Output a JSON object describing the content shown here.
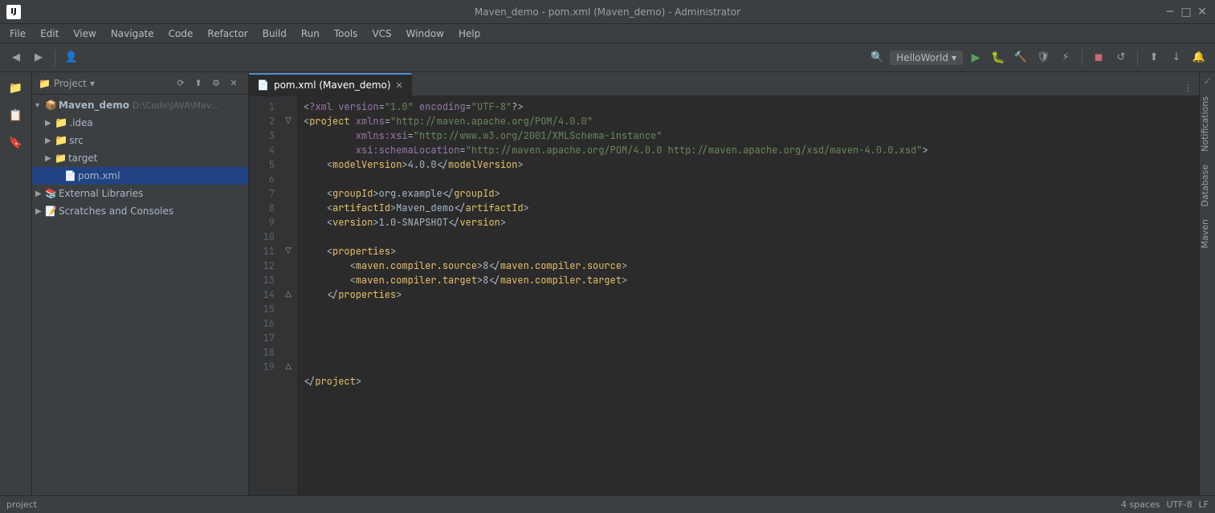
{
  "window": {
    "title": "Maven_demo - pom.xml (Maven_demo) - Administrator",
    "logo": "IJ"
  },
  "titleBar": {
    "title": "Maven_demo - pom.xml (Maven_demo) - Administrator",
    "minimize": "─",
    "maximize": "□",
    "close": "✕"
  },
  "menuBar": {
    "items": [
      "File",
      "Edit",
      "View",
      "Navigate",
      "Code",
      "Refactor",
      "Build",
      "Run",
      "Tools",
      "VCS",
      "Window",
      "Help"
    ]
  },
  "breadcrumb": {
    "project": "Maven_demo",
    "file": "pom.xml"
  },
  "toolbar": {
    "runConfig": "HelloWorld",
    "runLabel": "▶",
    "buildLabel": "🔨"
  },
  "projectPanel": {
    "title": "Project",
    "rootItem": {
      "name": "Maven_demo",
      "path": "D:\\Code\\JAVA\\Mav...",
      "expanded": true
    },
    "items": [
      {
        "id": "idea",
        "label": ".idea",
        "type": "folder",
        "indent": 1,
        "expanded": false
      },
      {
        "id": "src",
        "label": "src",
        "type": "folder",
        "indent": 1,
        "expanded": false
      },
      {
        "id": "target",
        "label": "target",
        "type": "folder-orange",
        "indent": 1,
        "expanded": false
      },
      {
        "id": "pom",
        "label": "pom.xml",
        "type": "file-xml",
        "indent": 2,
        "selected": true
      },
      {
        "id": "external",
        "label": "External Libraries",
        "type": "library",
        "indent": 0,
        "expanded": false
      },
      {
        "id": "scratches",
        "label": "Scratches and Consoles",
        "type": "scratches",
        "indent": 0
      }
    ]
  },
  "editor": {
    "tabs": [
      {
        "label": "pom.xml (Maven_demo)",
        "active": true,
        "closable": true
      }
    ],
    "lines": [
      {
        "num": 1,
        "content": "<?xml version=\"1.0\" encoding=\"UTF-8\"?>",
        "gutter": ""
      },
      {
        "num": 2,
        "content": "<project xmlns=\"http://maven.apache.org/POM/4.0.0\"",
        "gutter": "fold"
      },
      {
        "num": 3,
        "content": "         xmlns:xsi=\"http://www.w3.org/2001/XMLSchema-instance\"",
        "gutter": ""
      },
      {
        "num": 4,
        "content": "         xsi:schemaLocation=\"http://maven.apache.org/POM/4.0.0 http://maven.apache.org/xsd/maven-4.0.0.xsd\">",
        "gutter": ""
      },
      {
        "num": 5,
        "content": "    <modelVersion>4.0.0</modelVersion>",
        "gutter": ""
      },
      {
        "num": 6,
        "content": "",
        "gutter": ""
      },
      {
        "num": 7,
        "content": "    <groupId>org.example</groupId>",
        "gutter": ""
      },
      {
        "num": 8,
        "content": "    <artifactId>Maven_demo</artifactId>",
        "gutter": ""
      },
      {
        "num": 9,
        "content": "    <version>1.0-SNAPSHOT</version>",
        "gutter": ""
      },
      {
        "num": 10,
        "content": "",
        "gutter": ""
      },
      {
        "num": 11,
        "content": "    <properties>",
        "gutter": "fold"
      },
      {
        "num": 12,
        "content": "        <maven.compiler.source>8</maven.compiler.source>",
        "gutter": ""
      },
      {
        "num": 13,
        "content": "        <maven.compiler.target>8</maven.compiler.target>",
        "gutter": ""
      },
      {
        "num": 14,
        "content": "    </properties>",
        "gutter": "fold-end"
      },
      {
        "num": 15,
        "content": "",
        "gutter": ""
      },
      {
        "num": 16,
        "content": "",
        "gutter": ""
      },
      {
        "num": 17,
        "content": "",
        "gutter": ""
      },
      {
        "num": 18,
        "content": "",
        "gutter": ""
      },
      {
        "num": 19,
        "content": "</project>",
        "gutter": "fold-end"
      }
    ]
  },
  "rightStrip": {
    "panels": [
      "Notifications",
      "Database",
      "Maven"
    ]
  },
  "statusBar": {
    "projectLabel": "project",
    "encoding": "UTF-8",
    "lineEnding": "LF",
    "indent": "4 spaces"
  }
}
